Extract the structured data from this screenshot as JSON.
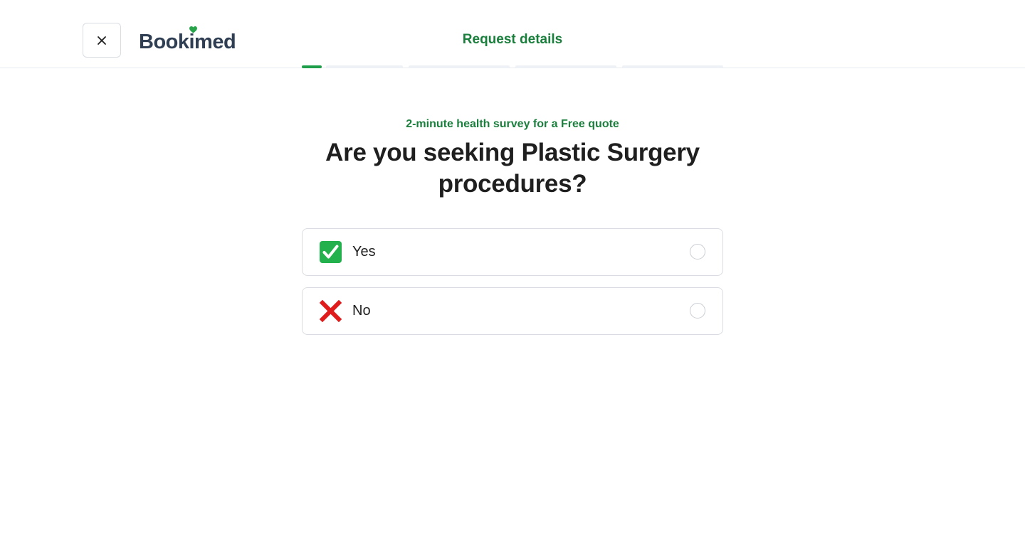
{
  "header": {
    "logo_text": "Bookimed",
    "title": "Request details",
    "close_icon": "close-icon"
  },
  "progress": {
    "total_steps": 5,
    "current_step": 1,
    "current_step_fill": 0.2
  },
  "survey": {
    "subtitle": "2-minute health survey for a Free quote",
    "question": "Are you seeking Plastic Surgery procedures?",
    "options": [
      {
        "label": "Yes",
        "icon": "check-mark-button-icon",
        "selected": false
      },
      {
        "label": "No",
        "icon": "cross-mark-icon",
        "selected": false
      }
    ]
  },
  "colors": {
    "brand_green": "#1a7f3c",
    "progress_green": "#1e9e4a",
    "logo_navy": "#2f3e52",
    "heart_green": "#27a44a",
    "check_green": "#22b14c",
    "cross_red": "#e01b1b"
  }
}
